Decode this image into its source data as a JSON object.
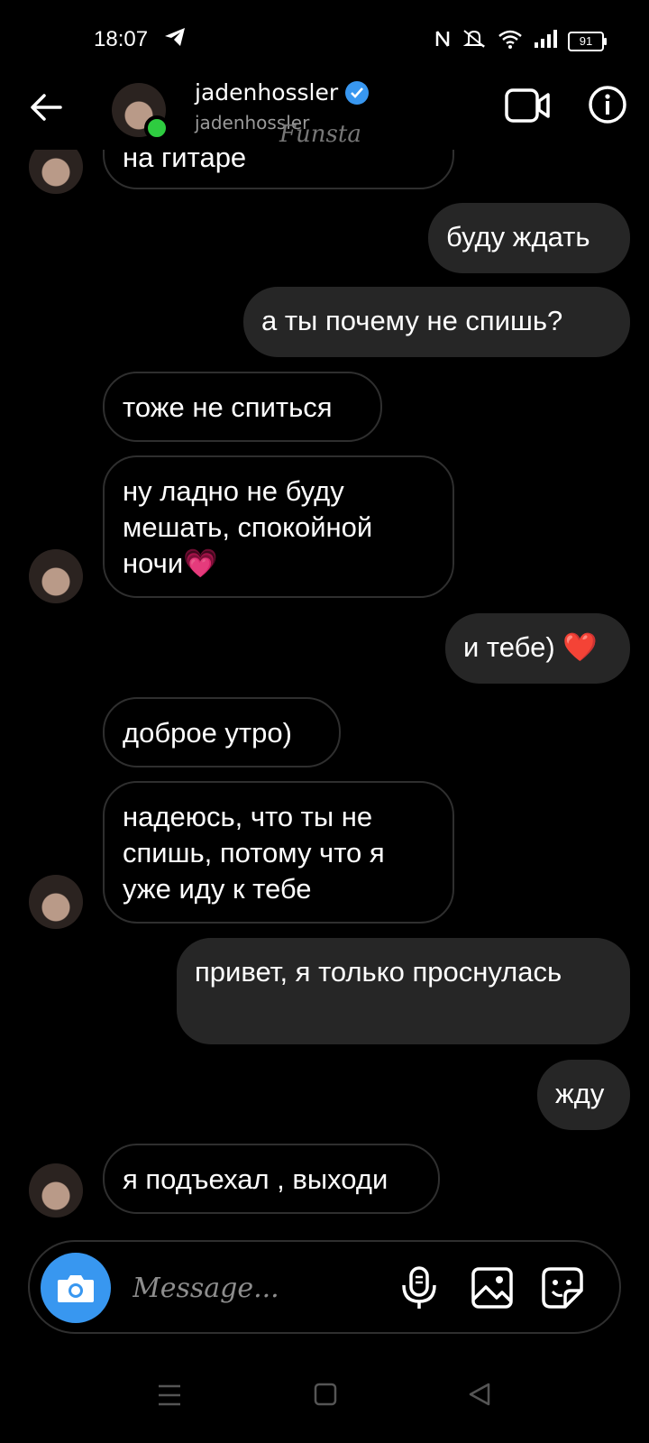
{
  "status_bar": {
    "time": "18:07",
    "battery": "91"
  },
  "header": {
    "name": "jadenhossler",
    "username": "jadenhossler",
    "watermark": "Funsta",
    "online_color": "#2ecc40",
    "verified_color": "#3897f0"
  },
  "messages": [
    {
      "side": "in",
      "text": "на гитаре"
    },
    {
      "side": "out",
      "text": "буду ждать"
    },
    {
      "side": "out",
      "text": "а ты почему не спишь?"
    },
    {
      "side": "in",
      "text": "тоже не спиться"
    },
    {
      "side": "in",
      "text": "ну ладно не буду мешать, спокойной ночи💗"
    },
    {
      "side": "out",
      "text": "и тебе) ❤️"
    },
    {
      "side": "in",
      "text": "доброе утро)"
    },
    {
      "side": "in",
      "text": "надеюсь, что ты не спишь, потому что я уже иду к тебе"
    },
    {
      "side": "out",
      "text": "привет, я только проснулась"
    },
    {
      "side": "out",
      "text": "жду"
    },
    {
      "side": "in",
      "text": "я подъехал , выходи"
    }
  ],
  "composer": {
    "placeholder": "Message...",
    "icons": [
      "camera-icon",
      "microphone-icon",
      "gallery-icon",
      "sticker-icon"
    ],
    "camera_color": "#3897f0"
  },
  "nav_bar": {
    "icons": [
      "menu-icon",
      "home-icon",
      "back-triangle-icon"
    ]
  }
}
